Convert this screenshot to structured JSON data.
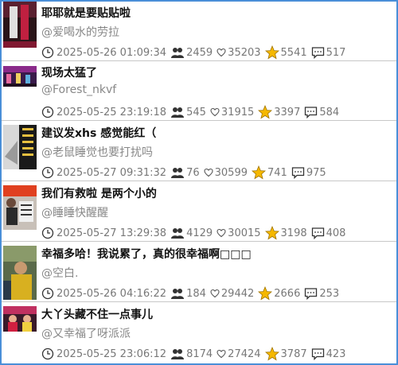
{
  "posts": [
    {
      "title": "耶耶就是要贴贴啦",
      "author": "@爱喝水的劳拉",
      "time": "2025-05-26 01:09:34",
      "views": "2459",
      "likes": "35203",
      "stars": "5541",
      "comments": "517"
    },
    {
      "title": "现场太猛了",
      "author": "@Forest_nkvf",
      "time": "2025-05-25 23:19:18",
      "views": "545",
      "likes": "31915",
      "stars": "3397",
      "comments": "584"
    },
    {
      "title": "建议发xhs 感觉能红（",
      "author": "@老鼠睡觉也要打扰吗",
      "time": "2025-05-27 09:31:32",
      "views": "76",
      "likes": "30599",
      "stars": "741",
      "comments": "975"
    },
    {
      "title": "我们有救啦 是两个小的",
      "author": "@睡睡快醒醒",
      "time": "2025-05-27 13:29:38",
      "views": "4129",
      "likes": "30015",
      "stars": "3198",
      "comments": "408"
    },
    {
      "title": "幸福多哈！我说累了，真的很幸福啊□□□",
      "author": "@空白.",
      "time": "2025-05-26 04:16:22",
      "views": "184",
      "likes": "29442",
      "stars": "2666",
      "comments": "253"
    },
    {
      "title": "大丫头藏不住一点事儿",
      "author": "@又幸福了呀派派",
      "time": "2025-05-25 23:06:12",
      "views": "8174",
      "likes": "27424",
      "stars": "3787",
      "comments": "423"
    }
  ],
  "icons": {
    "time": "clock-icon",
    "views": "people-icon",
    "likes": "heart-icon",
    "stars": "star-icon",
    "comments": "comment-icon"
  },
  "colors": {
    "border": "#4a8fd8",
    "star": "#f5b800",
    "title": "#111111",
    "muted": "#888888"
  }
}
